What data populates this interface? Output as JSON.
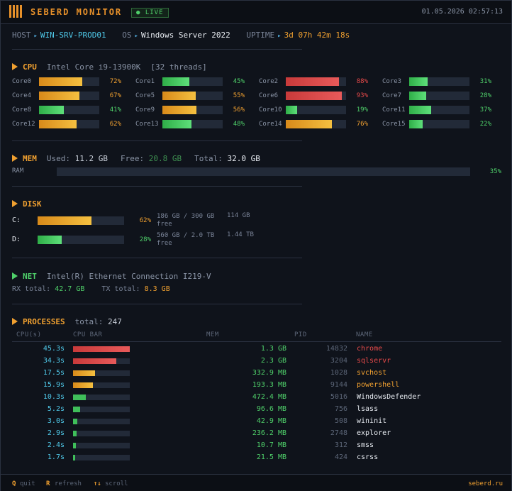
{
  "titlebar": {
    "app_title": "SEBERD MONITOR",
    "live_badge": "● LIVE",
    "datetime": "01.05.2026 02:57:13"
  },
  "host": {
    "host_key": "HOST",
    "host_value": "WIN-SRV-PROD01",
    "os_key": "OS",
    "os_value": "Windows Server 2022",
    "uptime_key": "UPTIME",
    "uptime_value": "3d 07h 42m 18s",
    "arrow": "▸"
  },
  "cpu": {
    "title": "CPU",
    "model": "Intel Core i9-13900K",
    "threads": "[32 threads]",
    "cores": [
      {
        "label": "Core0",
        "pct": 72,
        "pct_text": "72%"
      },
      {
        "label": "Core1",
        "pct": 45,
        "pct_text": "45%"
      },
      {
        "label": "Core2",
        "pct": 88,
        "pct_text": "88%"
      },
      {
        "label": "Core3",
        "pct": 31,
        "pct_text": "31%"
      },
      {
        "label": "Core4",
        "pct": 67,
        "pct_text": "67%"
      },
      {
        "label": "Core5",
        "pct": 55,
        "pct_text": "55%"
      },
      {
        "label": "Core6",
        "pct": 93,
        "pct_text": "93%"
      },
      {
        "label": "Core7",
        "pct": 28,
        "pct_text": "28%"
      },
      {
        "label": "Core8",
        "pct": 41,
        "pct_text": "41%"
      },
      {
        "label": "Core9",
        "pct": 56,
        "pct_text": "56%"
      },
      {
        "label": "Core10",
        "pct": 19,
        "pct_text": "19%"
      },
      {
        "label": "Core11",
        "pct": 37,
        "pct_text": "37%"
      },
      {
        "label": "Core12",
        "pct": 62,
        "pct_text": "62%"
      },
      {
        "label": "Core13",
        "pct": 48,
        "pct_text": "48%"
      },
      {
        "label": "Core14",
        "pct": 76,
        "pct_text": "76%"
      },
      {
        "label": "Core15",
        "pct": 22,
        "pct_text": "22%"
      }
    ]
  },
  "mem": {
    "title": "MEM",
    "used_label": "Used:",
    "used_value": "11.2 GB",
    "free_label": "Free:",
    "free_value": "20.8 GB",
    "total_label": "Total:",
    "total_value": "32.0 GB",
    "ram_label": "RAM",
    "ram_pct": 35,
    "ram_pct_text": "35%"
  },
  "disk": {
    "title": "DISK",
    "drives": [
      {
        "letter": "C:",
        "pct": 62,
        "pct_text": "62%",
        "usage": "186 GB / 300 GB",
        "free_amount": "114 GB",
        "free_word": "free"
      },
      {
        "letter": "D:",
        "pct": 28,
        "pct_text": "28%",
        "usage": "560 GB / 2.0 TB",
        "free_amount": "1.44 TB",
        "free_word": "free"
      }
    ]
  },
  "net": {
    "title": "NET",
    "adapter": "Intel(R) Ethernet Connection I219-V",
    "rx_label": "RX total:",
    "rx_value": "42.7 GB",
    "tx_label": "TX total:",
    "tx_value": "8.3 GB"
  },
  "processes": {
    "title": "PROCESSES",
    "total_label": "total:",
    "total_value": "247",
    "columns": {
      "cpu": "CPU(s)",
      "bar": "CPU BAR",
      "mem": "MEM",
      "pid": "PID",
      "name": "NAME"
    },
    "rows": [
      {
        "cpu": "45.3s",
        "bar": 1.0,
        "mem": "1.3 GB",
        "pid": "14832",
        "name": "chrome",
        "color": "#e84a4a"
      },
      {
        "cpu": "34.3s",
        "bar": 0.76,
        "mem": "2.3 GB",
        "pid": "3204",
        "name": "sqlservr",
        "color": "#e84a4a"
      },
      {
        "cpu": "17.5s",
        "bar": 0.39,
        "mem": "332.9 MB",
        "pid": "1028",
        "name": "svchost",
        "color": "#f0a030"
      },
      {
        "cpu": "15.9s",
        "bar": 0.35,
        "mem": "193.3 MB",
        "pid": "9144",
        "name": "powershell",
        "color": "#f0a030"
      },
      {
        "cpu": "10.3s",
        "bar": 0.23,
        "mem": "472.4 MB",
        "pid": "5016",
        "name": "WindowsDefender",
        "color": "#e8ecf2"
      },
      {
        "cpu": "5.2s",
        "bar": 0.12,
        "mem": "96.6 MB",
        "pid": "756",
        "name": "lsass",
        "color": "#e8ecf2"
      },
      {
        "cpu": "3.0s",
        "bar": 0.07,
        "mem": "42.9 MB",
        "pid": "508",
        "name": "wininit",
        "color": "#e8ecf2"
      },
      {
        "cpu": "2.9s",
        "bar": 0.06,
        "mem": "236.2 MB",
        "pid": "2748",
        "name": "explorer",
        "color": "#e8ecf2"
      },
      {
        "cpu": "2.4s",
        "bar": 0.05,
        "mem": "10.7 MB",
        "pid": "312",
        "name": "smss",
        "color": "#e8ecf2"
      },
      {
        "cpu": "1.7s",
        "bar": 0.04,
        "mem": "21.5 MB",
        "pid": "424",
        "name": "csrss",
        "color": "#e8ecf2"
      }
    ]
  },
  "footer": {
    "quit_key": "Q",
    "quit_label": "quit",
    "refresh_key": "R",
    "refresh_label": "refresh",
    "scroll_key": "↑↓",
    "scroll_label": "scroll",
    "site": "seberd.ru"
  },
  "colors": {
    "accent": "#f0a030",
    "green": "#4fd06a",
    "red": "#e84a4a",
    "cyan": "#4fc8e8"
  },
  "icons": {
    "logo": "bars-logo-icon",
    "section_marker": "triangle-right-icon",
    "live_dot": "dot-icon"
  }
}
